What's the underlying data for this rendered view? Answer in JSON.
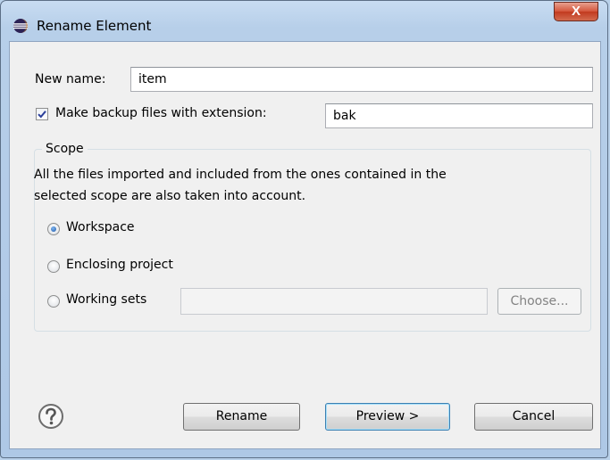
{
  "window": {
    "title": "Rename Element",
    "close_glyph": "X"
  },
  "new_name": {
    "label": "New name:",
    "value": "item"
  },
  "backup": {
    "label": "Make backup files with extension:",
    "checked": true,
    "value": "bak"
  },
  "scope": {
    "title": "Scope",
    "description_line1": "All the files imported and included from the ones contained in the",
    "description_line2": "selected scope are also taken into account.",
    "options": [
      {
        "label": "Workspace",
        "checked": true
      },
      {
        "label": "Enclosing project",
        "checked": false
      },
      {
        "label": "Working sets",
        "checked": false
      }
    ],
    "working_sets_value": "",
    "choose_label": "Choose..."
  },
  "buttons": {
    "rename": "Rename",
    "preview": "Preview >",
    "cancel": "Cancel"
  },
  "icons": {
    "app": "eclipse-icon",
    "help": "help-icon",
    "close": "close-icon"
  },
  "colors": {
    "accent": "#1d58a8",
    "close": "#c23a1f"
  }
}
